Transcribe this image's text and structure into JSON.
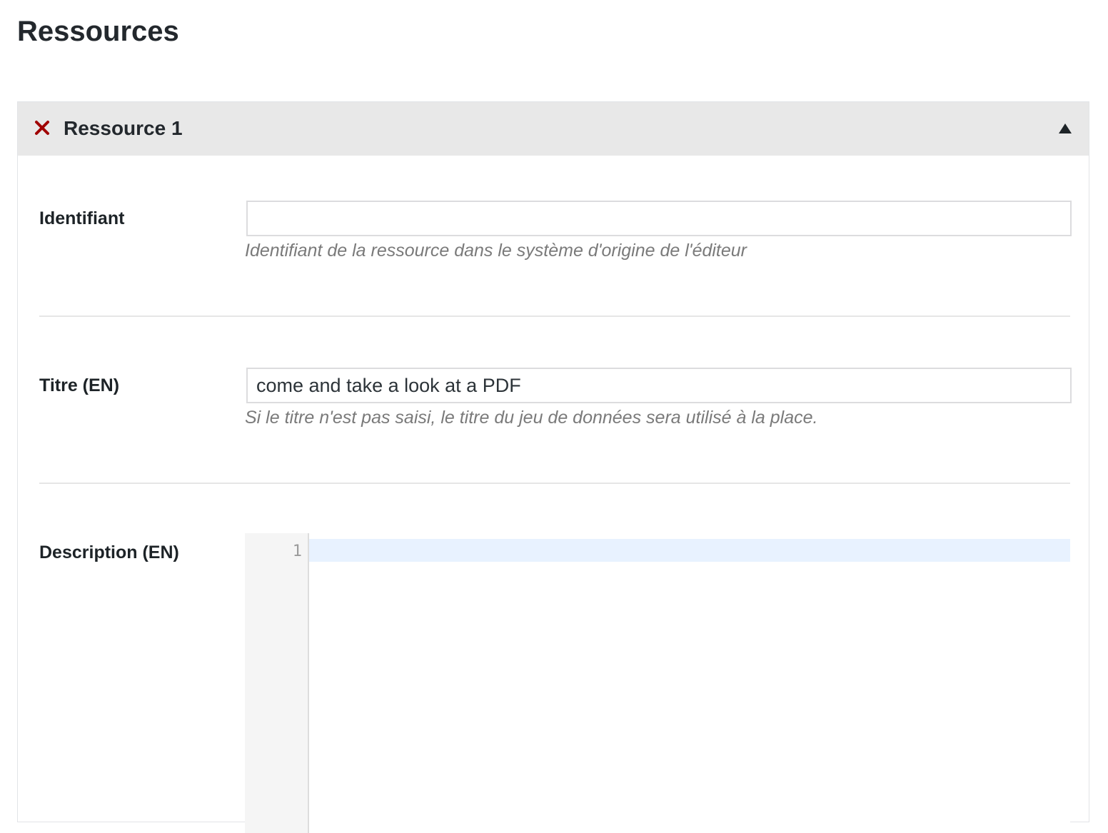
{
  "page": {
    "title": "Ressources"
  },
  "resource_panel": {
    "title": "Ressource 1",
    "remove_icon": "close-x-icon",
    "remove_color": "#a00000",
    "toggle_icon": "triangle-up-icon"
  },
  "fields": {
    "identifier": {
      "label": "Identifiant",
      "value": "",
      "help": "Identifiant de la ressource dans le système d'origine de l'éditeur"
    },
    "title_en": {
      "label": "Titre (EN)",
      "value": "come and take a look at a PDF",
      "help": "Si le titre n'est pas saisi, le titre du jeu de données sera utilisé à la place."
    },
    "description_en": {
      "label": "Description (EN)",
      "line_numbers": [
        "1"
      ],
      "active_line_color": "#e8f2ff"
    }
  }
}
